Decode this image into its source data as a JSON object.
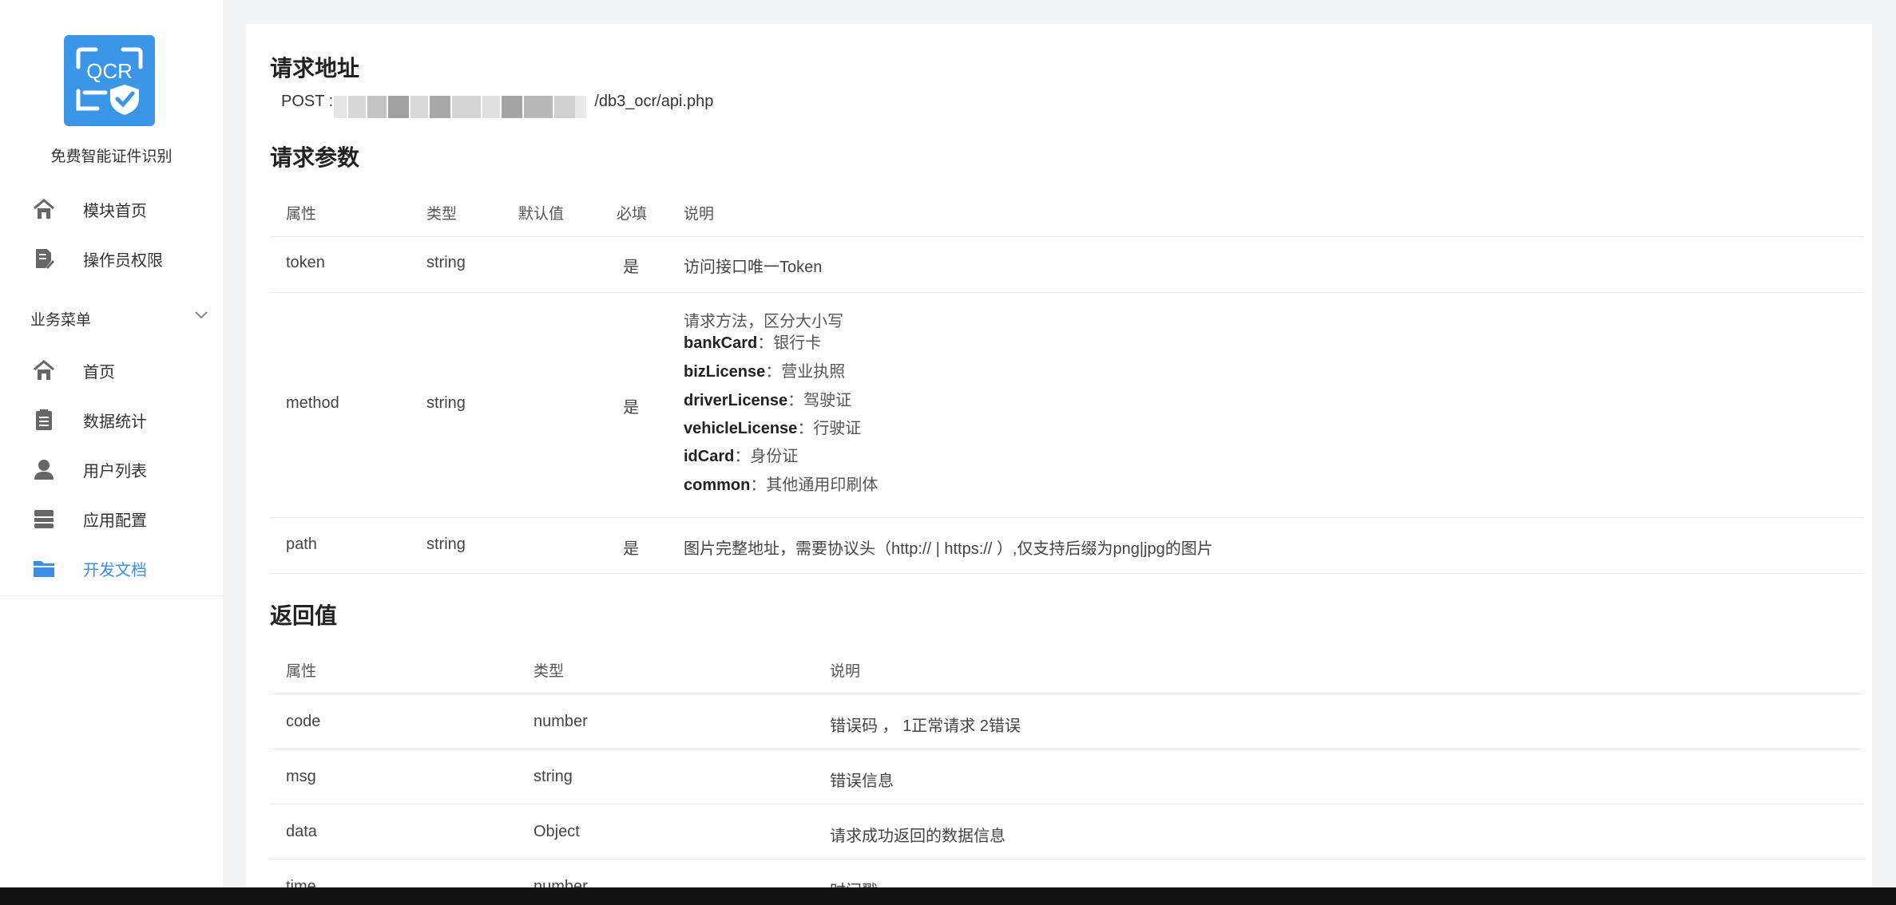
{
  "sidebar": {
    "logo_text": "QCR",
    "app_name": "免费智能证件识别",
    "top_items": [
      {
        "label": "模块首页",
        "icon": "home-icon"
      },
      {
        "label": "操作员权限",
        "icon": "document-edit-icon"
      }
    ],
    "group_title": "业务菜单",
    "group_items": [
      {
        "label": "首页",
        "icon": "home-icon"
      },
      {
        "label": "数据统计",
        "icon": "clipboard-icon"
      },
      {
        "label": "用户列表",
        "icon": "user-icon"
      },
      {
        "label": "应用配置",
        "icon": "server-icon"
      },
      {
        "label": "开发文档",
        "icon": "folder-icon",
        "active": true
      }
    ]
  },
  "request_address": {
    "heading": "请求地址",
    "method_prefix": "POST :",
    "url_visible_tail": "/db3_ocr/api.php"
  },
  "request_params": {
    "heading": "请求参数",
    "columns": [
      "属性",
      "类型",
      "默认值",
      "必填",
      "说明"
    ],
    "rows": [
      {
        "attr": "token",
        "type": "string",
        "default": "",
        "required": "是",
        "desc": "访问接口唯一Token"
      },
      {
        "attr": "method",
        "type": "string",
        "default": "",
        "required": "是",
        "desc_intro": "请求方法，区分大小写",
        "desc_items": [
          {
            "key": "bankCard",
            "sep": "：",
            "val": "银行卡"
          },
          {
            "key": "bizLicense",
            "sep": "：",
            "val": "营业执照"
          },
          {
            "key": "driverLicense",
            "sep": "：",
            "val": "驾驶证"
          },
          {
            "key": "vehicleLicense",
            "sep": "：",
            "val": "行驶证"
          },
          {
            "key": "idCard",
            "sep": "：",
            "val": "身份证"
          },
          {
            "key": "common",
            "sep": "：",
            "val": "其他通用印刷体"
          }
        ]
      },
      {
        "attr": "path",
        "type": "string",
        "default": "",
        "required": "是",
        "desc": "图片完整地址，需要协议头（http:// | https:// ）,仅支持后缀为png|jpg的图片"
      }
    ]
  },
  "return_values": {
    "heading": "返回值",
    "columns": [
      "属性",
      "类型",
      "说明"
    ],
    "rows": [
      {
        "attr": "code",
        "type": "number",
        "desc": "错误码 ， 1正常请求 2错误"
      },
      {
        "attr": "msg",
        "type": "string",
        "desc": "错误信息"
      },
      {
        "attr": "data",
        "type": "Object",
        "desc": "请求成功返回的数据信息"
      },
      {
        "attr": "time",
        "type": "number",
        "desc": "时间戳"
      }
    ]
  },
  "colors": {
    "accent": "#3b8fe6",
    "logo_bg": "#3b96e8",
    "page_bg": "#f2f3f5"
  }
}
